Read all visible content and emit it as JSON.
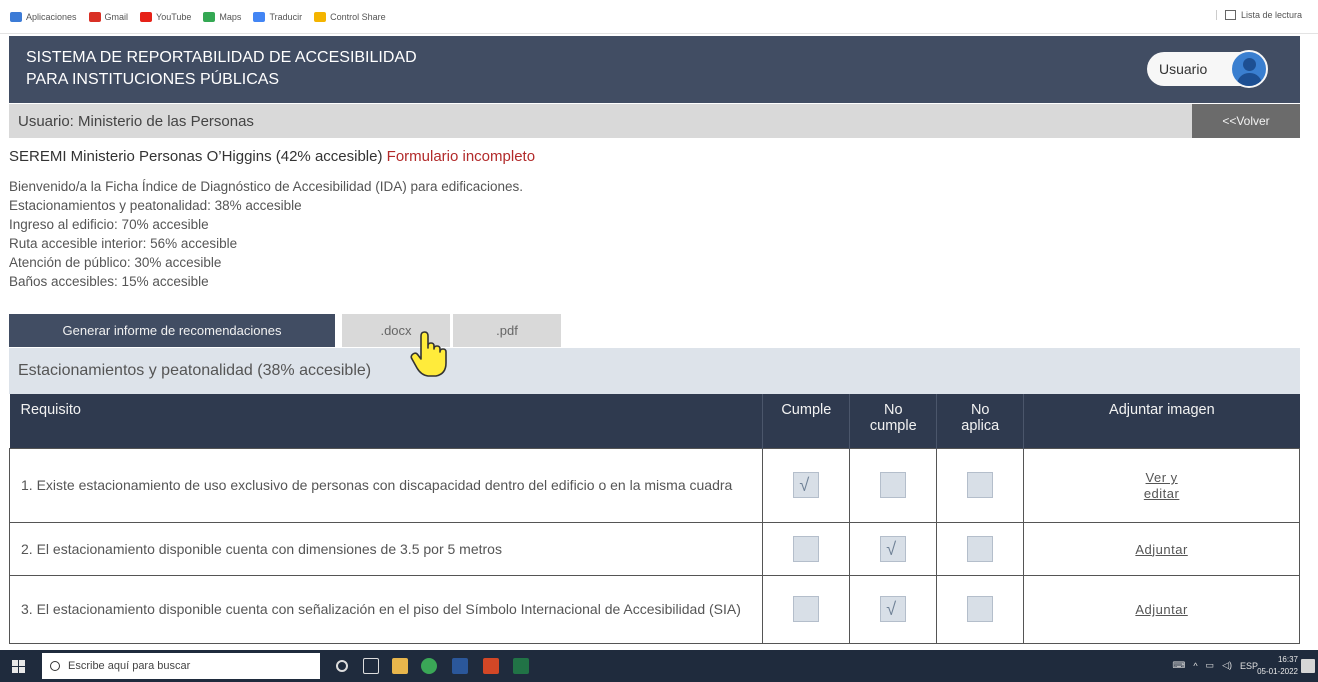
{
  "bookmarks": {
    "items": [
      {
        "label": "Aplicaciones",
        "color": "#3c7bd6"
      },
      {
        "label": "Gmail",
        "color": "#d93025"
      },
      {
        "label": "YouTube",
        "color": "#e62117"
      },
      {
        "label": "Maps",
        "color": "#34a853"
      },
      {
        "label": "Traducir",
        "color": "#4285f4"
      },
      {
        "label": "Control Share",
        "color": "#f4b400"
      }
    ],
    "reading_list": "Lista de lectura"
  },
  "header": {
    "title_line1": "SISTEMA DE REPORTABILIDAD DE ACCESIBILIDAD",
    "title_line2": "PARA INSTITUCIONES PÚBLICAS",
    "user_label": "Usuario"
  },
  "user_bar": {
    "label": "Usuario: Ministerio de las Personas",
    "back_button": "<<Volver"
  },
  "institution": {
    "name": "SEREMI Ministerio Personas O’Higgins (42% accesible)",
    "status": "Formulario incompleto"
  },
  "summary": [
    "Bienvenido/a la Ficha Índice de Diagnóstico de Accesibilidad (IDA) para edificaciones.",
    "Estacionamientos y peatonalidad: 38% accesible",
    "Ingreso al edificio: 70% accesible",
    "Ruta accesible interior: 56% accesible",
    "Atención de público: 30% accesible",
    "Baños accesibles: 15% accesible"
  ],
  "report": {
    "generate_button": "Generar informe de recomendaciones",
    "docx": ".docx",
    "pdf": ".pdf"
  },
  "section": {
    "title": "Estacionamientos y peatonalidad (38% accesible)"
  },
  "table": {
    "headers": {
      "requisito": "Requisito",
      "cumple": "Cumple",
      "no_cumple_1": "No",
      "no_cumple_2": "cumple",
      "no_aplica_1": "No",
      "no_aplica_2": "aplica",
      "adjuntar": "Adjuntar imagen"
    },
    "rows": [
      {
        "text": "1. Existe estacionamiento de uso exclusivo de personas con discapacidad dentro del edificio o en la misma cuadra",
        "selected": "cumple",
        "link_line1": "Ver y",
        "link_line2": "editar"
      },
      {
        "text": "2. El estacionamiento disponible cuenta con dimensiones de 3.5 por 5 metros",
        "selected": "no_cumple",
        "link_line1": "Adjuntar",
        "link_line2": ""
      },
      {
        "text": "3. El estacionamiento disponible cuenta con señalización en el piso del Símbolo Internacional de Accesibilidad (SIA)",
        "selected": "no_cumple",
        "link_line1": "Adjuntar",
        "link_line2": ""
      }
    ],
    "check_glyph": "√"
  },
  "taskbar": {
    "search_placeholder": "Escribe aquí para buscar",
    "lang": "ESP",
    "time": "16:37",
    "date": "05-01-2022",
    "tray_icons": [
      "keyboard-icon",
      "chevron-up-icon",
      "network-icon",
      "volume-icon"
    ]
  }
}
